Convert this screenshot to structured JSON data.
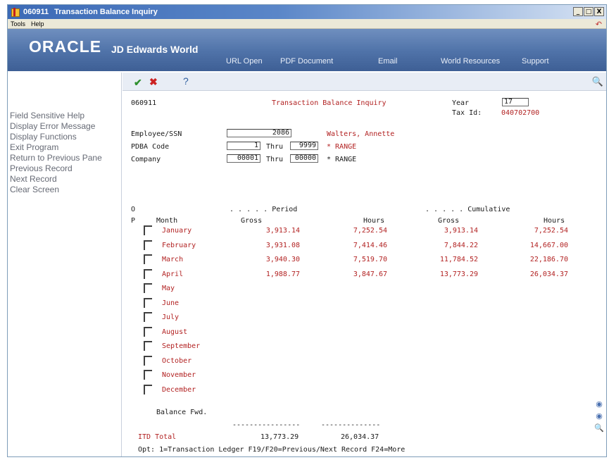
{
  "window": {
    "program_id": "060911",
    "title": "Transaction Balance Inquiry",
    "controls": [
      "_",
      "□",
      "X"
    ]
  },
  "menubar": {
    "items": [
      "Tools",
      "Help"
    ]
  },
  "banner": {
    "logo": "ORACLE",
    "logo_sub": "JD Edwards World",
    "nav": [
      "URL Open",
      "PDF Document",
      "Email",
      "World Resources",
      "Support"
    ]
  },
  "sidebar": {
    "items": [
      "Field Sensitive Help",
      "Display Error Message",
      "Display Functions",
      "Exit Program",
      "Return to Previous Pane",
      "Previous Record",
      "Next Record",
      "Clear Screen"
    ]
  },
  "toolbar": {
    "check": "✔",
    "cancel": "✖",
    "help": "?",
    "search": "🔍"
  },
  "form": {
    "program_id": "060911",
    "screen_title": "Transaction Balance Inquiry",
    "year_label": "Year",
    "year_value": "17",
    "taxid_label": "Tax Id:",
    "taxid_value": "040702700",
    "employee_label": "Employee/SSN",
    "employee_value": "2086",
    "employee_name": "Walters, Annette",
    "pdba_label": "PDBA Code",
    "pdba_from": "1",
    "thru_label": "Thru",
    "pdba_to": "9999",
    "pdba_range": "* RANGE",
    "company_label": "Company",
    "company_from": "00001",
    "company_to": "00000",
    "company_range": "* RANGE",
    "hdr_o": "O",
    "hdr_p": "P",
    "hdr_month": "Month",
    "hdr_period": ". . . . . Period",
    "hdr_cumulative": ". . . . . Cumulative",
    "hdr_gross": "Gross",
    "hdr_hours": "Hours",
    "hdr_gross2": "Gross",
    "hdr_hours2": "Hours",
    "rows": [
      {
        "month": "January",
        "pgross": "3,913.14",
        "phours": "7,252.54",
        "cgross": "3,913.14",
        "chours": "7,252.54"
      },
      {
        "month": "February",
        "pgross": "3,931.08",
        "phours": "7,414.46",
        "cgross": "7,844.22",
        "chours": "14,667.00"
      },
      {
        "month": "March",
        "pgross": "3,940.30",
        "phours": "7,519.70",
        "cgross": "11,784.52",
        "chours": "22,186.70"
      },
      {
        "month": "April",
        "pgross": "1,988.77",
        "phours": "3,847.67",
        "cgross": "13,773.29",
        "chours": "26,034.37"
      },
      {
        "month": "May",
        "pgross": "",
        "phours": "",
        "cgross": "",
        "chours": ""
      },
      {
        "month": "June",
        "pgross": "",
        "phours": "",
        "cgross": "",
        "chours": ""
      },
      {
        "month": "July",
        "pgross": "",
        "phours": "",
        "cgross": "",
        "chours": ""
      },
      {
        "month": "August",
        "pgross": "",
        "phours": "",
        "cgross": "",
        "chours": ""
      },
      {
        "month": "September",
        "pgross": "",
        "phours": "",
        "cgross": "",
        "chours": ""
      },
      {
        "month": "October",
        "pgross": "",
        "phours": "",
        "cgross": "",
        "chours": ""
      },
      {
        "month": "November",
        "pgross": "",
        "phours": "",
        "cgross": "",
        "chours": ""
      },
      {
        "month": "December",
        "pgross": "",
        "phours": "",
        "cgross": "",
        "chours": ""
      }
    ],
    "balance_fwd": "Balance Fwd.",
    "dashes1": "----------------",
    "dashes2": "--------------",
    "itd_label": "ITD Total",
    "itd_gross": "13,773.29",
    "itd_hours": "26,034.37",
    "footer": "Opt:  1=Transaction Ledger   F19/F20=Previous/Next Record   F24=More"
  }
}
